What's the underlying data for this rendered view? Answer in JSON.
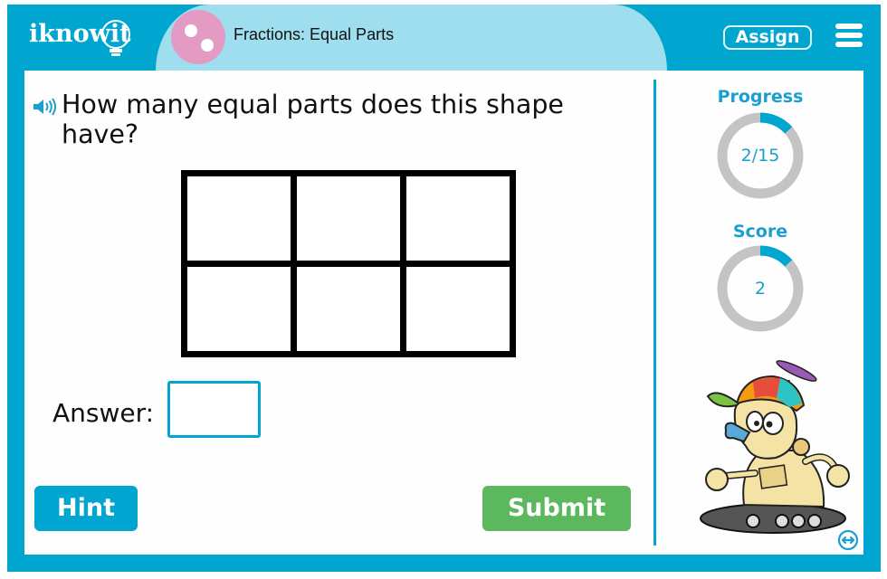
{
  "header": {
    "logo_text": "iknowit",
    "title": "Fractions: Equal Parts",
    "assign_label": "Assign",
    "menu_icon": "hamburger-menu-icon"
  },
  "question": {
    "speaker_icon": "speaker-icon",
    "text": "How many equal parts does this shape have?",
    "shape": {
      "type": "rectangle-grid",
      "rows": 2,
      "columns": 3,
      "parts": 6
    }
  },
  "answer": {
    "label": "Answer:",
    "value": "",
    "placeholder": ""
  },
  "buttons": {
    "hint": "Hint",
    "submit": "Submit"
  },
  "sidebar": {
    "progress": {
      "label": "Progress",
      "value_text": "2/15",
      "current": 2,
      "total": 15
    },
    "score": {
      "label": "Score",
      "value_text": "2",
      "fraction": 0.1333
    },
    "mascot": "robot-mascot-with-propeller-cap",
    "swap_icon": "swap-layout-icon"
  },
  "colors": {
    "frame": "#00a6cf",
    "title_pill": "#9edeef",
    "title_dot": "#e49bc3",
    "hint": "#00a6cf",
    "submit": "#5cb85c",
    "ring_track": "#c4c4c4",
    "ring_fill": "#00a6cf",
    "stat_text": "#1a9fcf"
  }
}
